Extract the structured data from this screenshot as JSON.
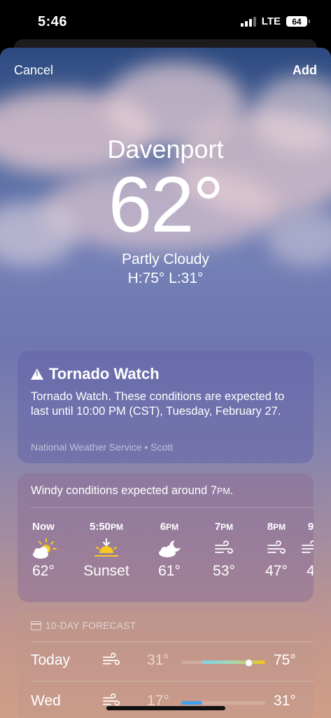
{
  "status_bar": {
    "time": "5:46",
    "network": "LTE",
    "battery": "64"
  },
  "header": {
    "cancel_label": "Cancel",
    "add_label": "Add"
  },
  "current": {
    "city": "Davenport",
    "temperature": "62°",
    "condition": "Partly Cloudy",
    "high_low": "H:75°  L:31°"
  },
  "alert": {
    "title": "Tornado Watch",
    "body": "Tornado Watch. These conditions are expected to last until 10:00 PM (CST), Tuesday, February 27.",
    "source": "National Weather Service • Scott"
  },
  "hourly": {
    "note_prefix": "Windy conditions expected around 7",
    "note_suffix": "PM",
    "note_end": ".",
    "items": [
      {
        "time": "Now",
        "suffix": "",
        "icon": "partly-sunny-icon",
        "value": "62°"
      },
      {
        "time": "5:50",
        "suffix": "PM",
        "icon": "sunset-icon",
        "value": "Sunset"
      },
      {
        "time": "6",
        "suffix": "PM",
        "icon": "partly-cloudy-night-icon",
        "value": "61°"
      },
      {
        "time": "7",
        "suffix": "PM",
        "icon": "wind-icon",
        "value": "53°"
      },
      {
        "time": "8",
        "suffix": "PM",
        "icon": "wind-icon",
        "value": "47°"
      },
      {
        "time": "9",
        "suffix": "",
        "icon": "wind-icon",
        "value": "4"
      }
    ]
  },
  "forecast": {
    "title": "10-DAY FORECAST",
    "days": [
      {
        "day": "Today",
        "icon": "wind-icon",
        "low": "31°",
        "high": "75°",
        "range_start": 0.25,
        "range_end": 1.0,
        "current": 0.78
      },
      {
        "day": "Wed",
        "icon": "wind-icon",
        "low": "17°",
        "high": "31°",
        "range_start": 0.0,
        "range_end": 0.25
      }
    ]
  },
  "colors": {
    "sky_top": "#2d4a80",
    "sky_mid": "#7380b6",
    "sky_bottom": "#d19e88",
    "sun_yellow": "#f8c825",
    "temp_bar_cool": "#7fd3e8",
    "temp_bar_warm": "#f5c518",
    "temp_bar_cold": "#3ea2f0"
  }
}
